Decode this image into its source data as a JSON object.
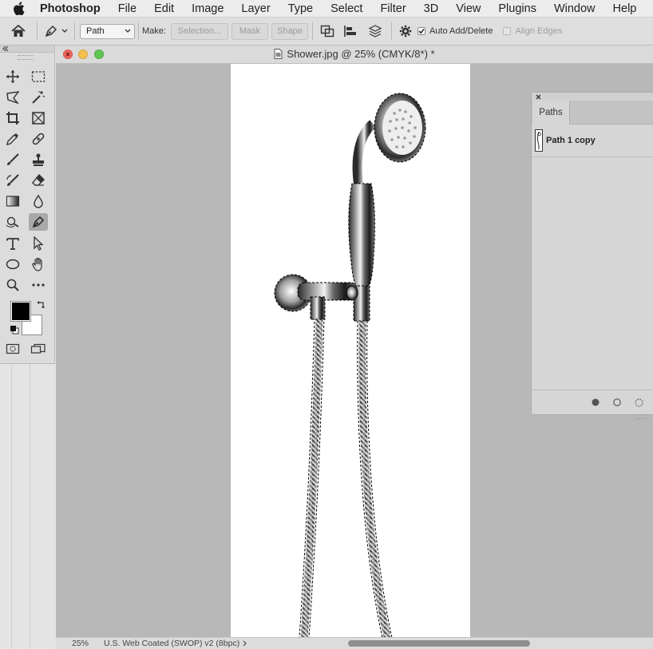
{
  "menubar": {
    "app_name": "Photoshop",
    "items": [
      "File",
      "Edit",
      "Image",
      "Layer",
      "Type",
      "Select",
      "Filter",
      "3D",
      "View",
      "Plugins",
      "Window",
      "Help"
    ]
  },
  "options_bar": {
    "mode_value": "Path",
    "make_label": "Make:",
    "selection_label": "Selection...",
    "mask_label": "Mask",
    "shape_label": "Shape",
    "auto_add_delete_label": "Auto Add/Delete",
    "auto_add_delete_checked": true,
    "align_edges_label": "Align Edges",
    "align_edges_checked": false
  },
  "document": {
    "title": "Shower.jpg @ 25% (CMYK/8*) *"
  },
  "status_bar": {
    "zoom": "25%",
    "profile": "U.S. Web Coated (SWOP) v2 (8bpc)"
  },
  "paths_panel": {
    "tab_label": "Paths",
    "items": [
      {
        "name": "Path 1 copy"
      }
    ]
  },
  "toolbar": {
    "active_tool": "pen-tool",
    "foreground_color": "#000000",
    "background_color": "#ffffff"
  },
  "icons": [
    "apple-icon",
    "home-icon",
    "pen-tool-icon",
    "chevron-down-icon",
    "path-operations-icon",
    "path-alignment-icon",
    "path-arrangement-icon",
    "gear-icon",
    "move-tool-icon",
    "marquee-tool-icon",
    "lasso-tool-icon",
    "magic-wand-icon",
    "crop-tool-icon",
    "frame-tool-icon",
    "eyedropper-icon",
    "healing-brush-icon",
    "brush-tool-icon",
    "clone-stamp-icon",
    "history-brush-icon",
    "eraser-icon",
    "gradient-tool-icon",
    "blur-tool-icon",
    "dodge-tool-icon",
    "type-tool-icon",
    "path-selection-icon",
    "ellipse-tool-icon",
    "hand-tool-icon",
    "zoom-tool-icon",
    "more-tools-icon",
    "swap-colors-icon",
    "default-colors-icon",
    "quick-mask-icon",
    "screen-mode-icon",
    "fill-path-icon",
    "stroke-path-icon",
    "load-selection-icon"
  ]
}
